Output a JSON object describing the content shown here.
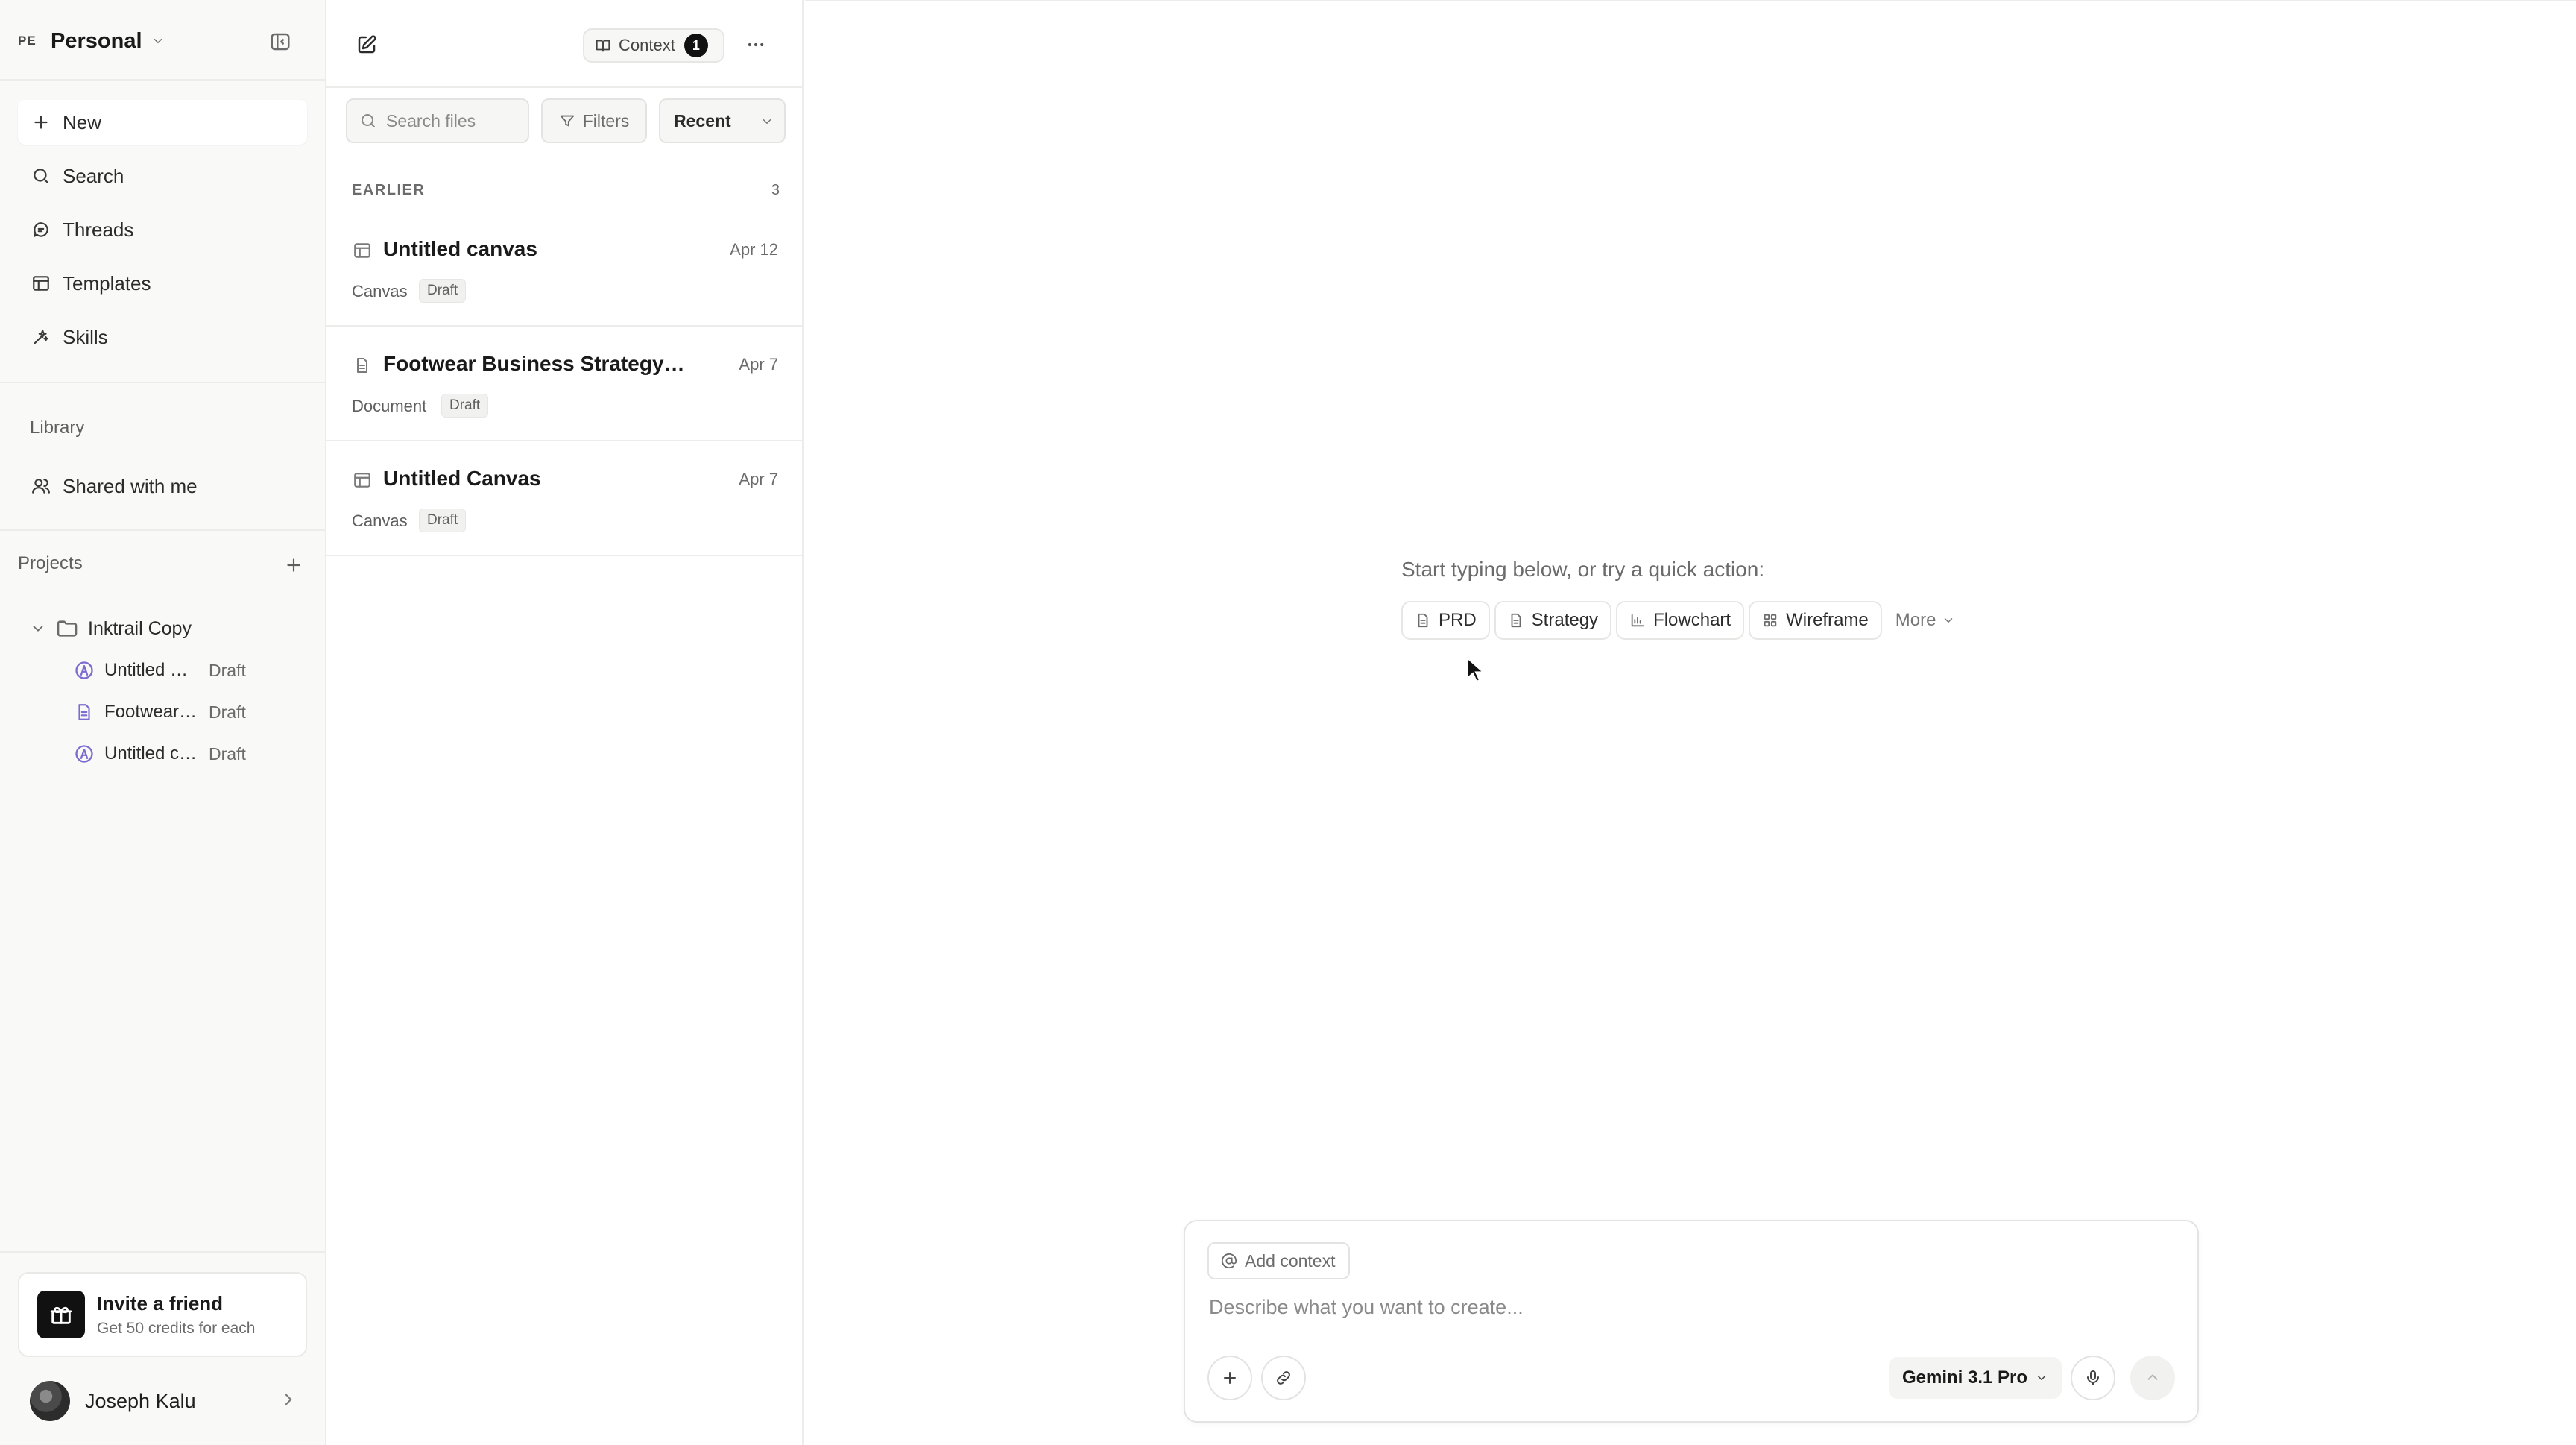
{
  "workspace": {
    "initials": "PE",
    "name": "Personal"
  },
  "nav": [
    {
      "label": "New",
      "icon": "plus-icon"
    },
    {
      "label": "Search",
      "icon": "search-icon"
    },
    {
      "label": "Threads",
      "icon": "chat-icon"
    },
    {
      "label": "Templates",
      "icon": "template-icon"
    },
    {
      "label": "Skills",
      "icon": "skills-icon"
    }
  ],
  "library": {
    "label": "Library",
    "items": [
      {
        "label": "Shared with me",
        "icon": "users-icon"
      }
    ]
  },
  "projects": {
    "label": "Projects",
    "folder": "Inktrail Copy",
    "items": [
      {
        "name": "Untitled Canvas",
        "status": "Draft",
        "icon": "canvas-icon"
      },
      {
        "name": "Footwear Business Strategy",
        "status": "Draft",
        "icon": "document-icon"
      },
      {
        "name": "Untitled canvas",
        "status": "Draft",
        "icon": "canvas-icon"
      }
    ]
  },
  "invite": {
    "title": "Invite a friend",
    "subtitle": "Get 50 credits for each"
  },
  "user": {
    "name": "Joseph Kalu"
  },
  "filepanel": {
    "context": {
      "label": "Context",
      "count": "1"
    },
    "search_placeholder": "Search files",
    "filters_label": "Filters",
    "sort_value": "Recent",
    "group": {
      "label": "EARLIER",
      "count": "3"
    },
    "files": [
      {
        "title": "Untitled canvas",
        "date": "Apr 12",
        "type": "Canvas",
        "status": "Draft",
        "icon": "canvas-icon"
      },
      {
        "title": "Footwear Business Strategy - Est…",
        "date": "Apr 7",
        "type": "Document",
        "status": "Draft",
        "icon": "document-icon"
      },
      {
        "title": "Untitled Canvas",
        "date": "Apr 7",
        "type": "Canvas",
        "status": "Draft",
        "icon": "canvas-icon"
      }
    ]
  },
  "main": {
    "prompt": "Start typing below, or try a quick action:",
    "quick_actions": [
      {
        "label": "PRD",
        "icon": "document-icon"
      },
      {
        "label": "Strategy",
        "icon": "document-icon"
      },
      {
        "label": "Flowchart",
        "icon": "chart-icon"
      },
      {
        "label": "Wireframe",
        "icon": "grid-icon"
      }
    ],
    "more_label": "More"
  },
  "composer": {
    "add_context_label": "Add context",
    "placeholder": "Describe what you want to create...",
    "model": "Gemini 3.1 Pro"
  }
}
